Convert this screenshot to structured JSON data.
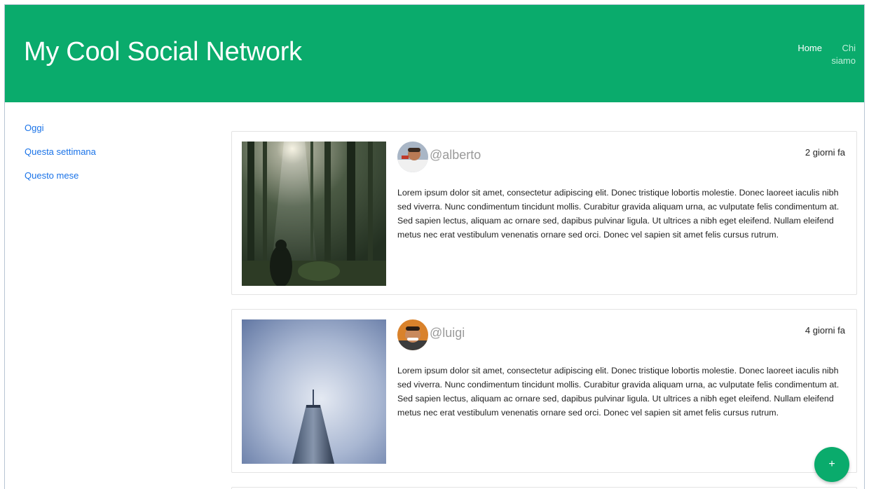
{
  "header": {
    "brand": "My Cool Social Network",
    "nav": {
      "home": "Home",
      "about": "Chi siamo"
    },
    "color": "#0aab6c"
  },
  "sidebar": {
    "items": [
      {
        "label": "Oggi"
      },
      {
        "label": "Questa settimana"
      },
      {
        "label": "Questo mese"
      }
    ]
  },
  "posts": [
    {
      "username": "@alberto",
      "time": "2 giorni fa",
      "text": "Lorem ipsum dolor sit amet, consectetur adipiscing elit. Donec tristique lobortis molestie. Donec laoreet iaculis nibh sed viverra. Nunc condimentum tincidunt mollis. Curabitur gravida aliquam urna, ac vulputate felis condimentum at. Sed sapien lectus, aliquam ac ornare sed, dapibus pulvinar ligula. Ut ultrices a nibh eget eleifend. Nullam eleifend metus nec erat vestibulum venenatis ornare sed orci. Donec vel sapien sit amet felis cursus rutrum."
    },
    {
      "username": "@luigi",
      "time": "4 giorni fa",
      "text": "Lorem ipsum dolor sit amet, consectetur adipiscing elit. Donec tristique lobortis molestie. Donec laoreet iaculis nibh sed viverra. Nunc condimentum tincidunt mollis. Curabitur gravida aliquam urna, ac vulputate felis condimentum at. Sed sapien lectus, aliquam ac ornare sed, dapibus pulvinar ligula. Ut ultrices a nibh eget eleifend. Nullam eleifend metus nec erat vestibulum venenatis ornare sed orci. Donec vel sapien sit amet felis cursus rutrum."
    }
  ],
  "fab": {
    "label": "+"
  }
}
